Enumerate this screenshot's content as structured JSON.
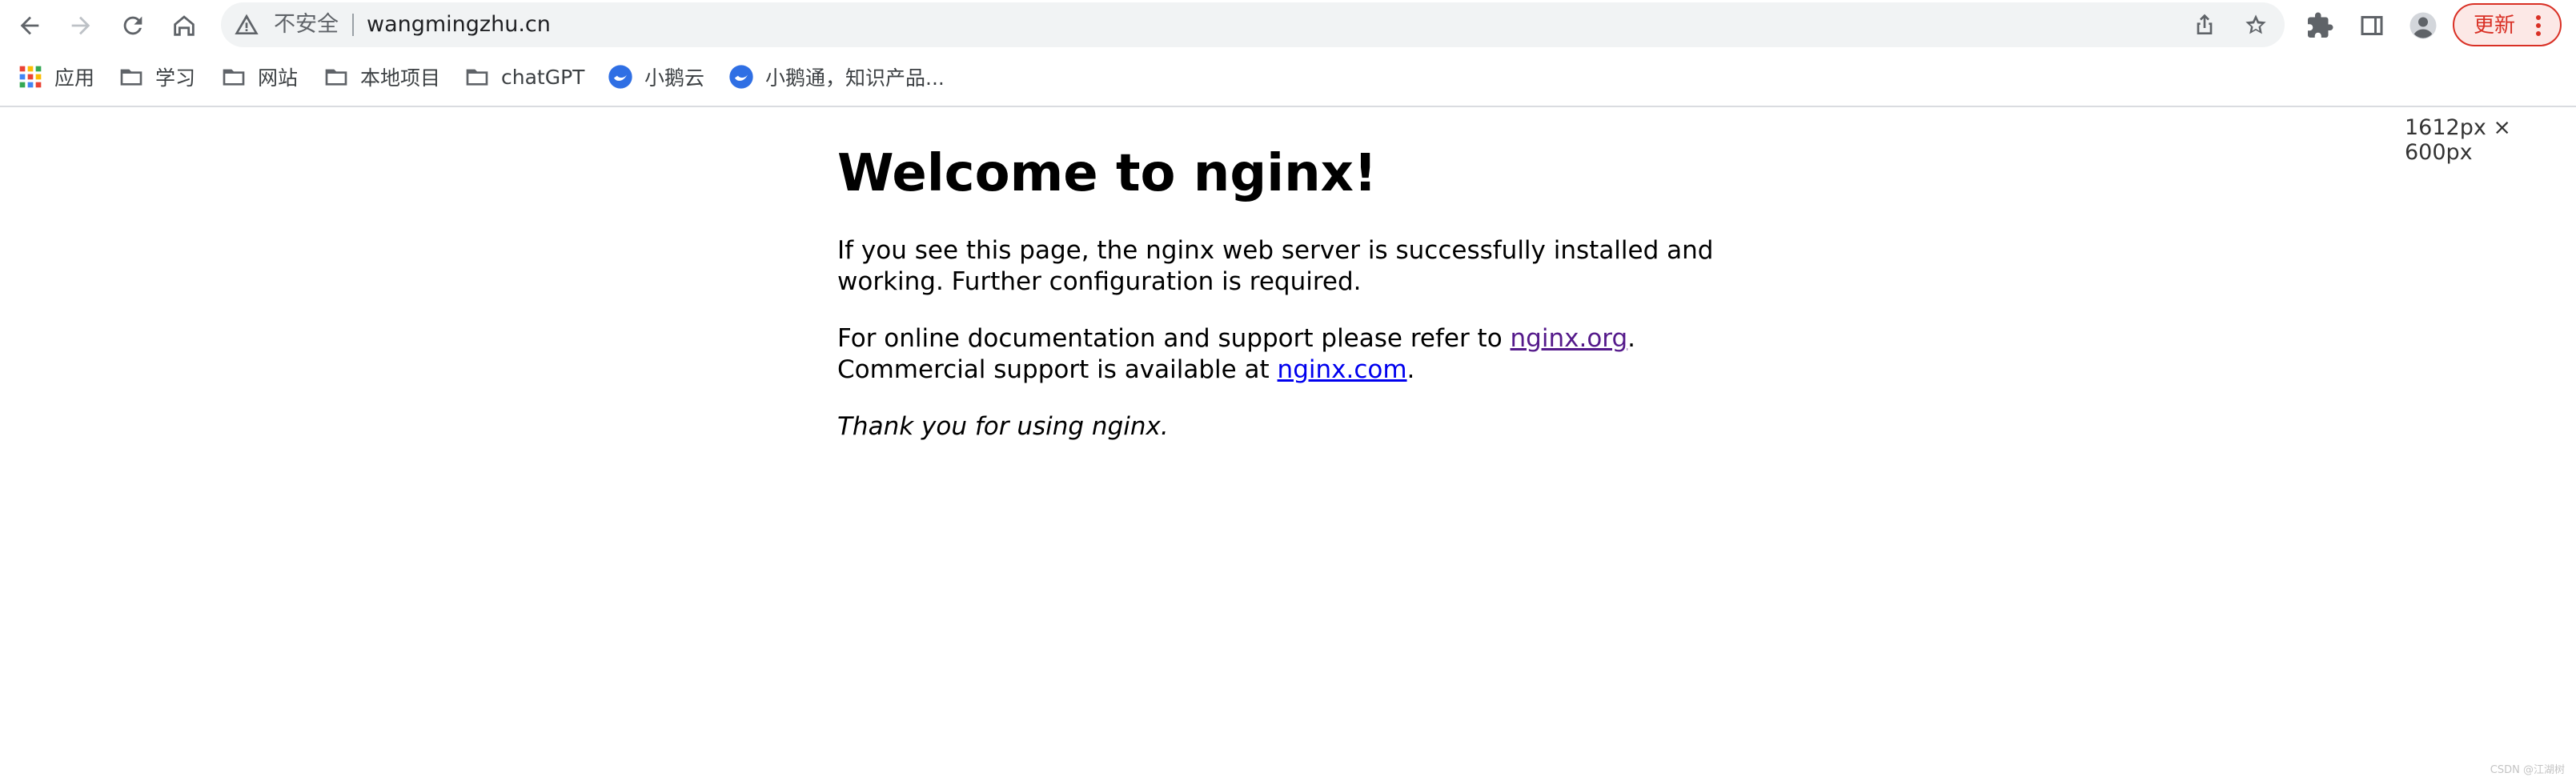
{
  "browser": {
    "address_bar": {
      "security_label": "不安全",
      "url": "wangmingzhu.cn"
    },
    "update_button_label": "更新",
    "icons": [
      "back-icon",
      "forward-icon",
      "reload-icon",
      "home-icon",
      "warning-icon",
      "share-icon",
      "bookmark-star-icon",
      "extensions-icon",
      "side-panel-icon",
      "profile-icon",
      "more-icon"
    ]
  },
  "bookmarks": {
    "items": [
      {
        "label": "应用",
        "icon": "apps-grid-icon"
      },
      {
        "label": "学习",
        "icon": "folder-icon"
      },
      {
        "label": "网站",
        "icon": "folder-icon"
      },
      {
        "label": "本地项目",
        "icon": "folder-icon"
      },
      {
        "label": "chatGPT",
        "icon": "folder-icon"
      },
      {
        "label": "小鹅云",
        "icon": "site-favicon"
      },
      {
        "label": "小鹅通，知识产品...",
        "icon": "site-favicon"
      }
    ]
  },
  "viewport_size_label": "1612px × 600px",
  "page": {
    "heading": "Welcome to nginx!",
    "para1": "If you see this page, the nginx web server is successfully installed and working. Further configuration is required.",
    "para2_prefix": "For online documentation and support please refer to ",
    "link_org": "nginx.org",
    "para2_mid": ".",
    "para2_line2_prefix": "Commercial support is available at ",
    "link_com": "nginx.com",
    "para2_end": ".",
    "para3": "Thank you for using nginx."
  },
  "watermark": "CSDN @江湖树"
}
